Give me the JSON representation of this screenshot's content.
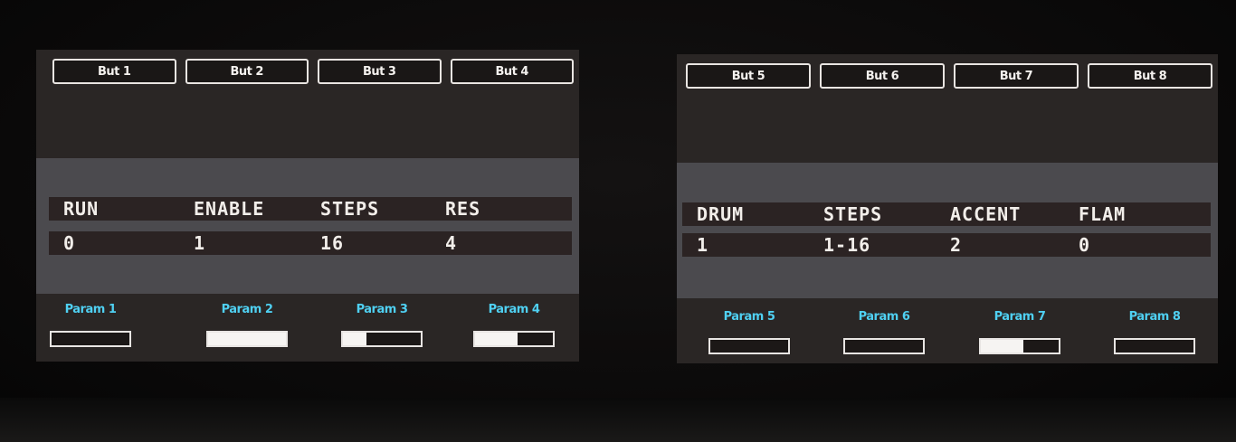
{
  "left_screen": {
    "buttons": [
      {
        "label": "But 1"
      },
      {
        "label": "But 2"
      },
      {
        "label": "But 3"
      },
      {
        "label": "But 4"
      }
    ],
    "columns": [
      {
        "label": "RUN",
        "value": "0"
      },
      {
        "label": "ENABLE",
        "value": "1"
      },
      {
        "label": "STEPS",
        "value": "16"
      },
      {
        "label": "RES",
        "value": "4"
      }
    ],
    "params": [
      {
        "label": "Param 1",
        "fill": 0.0
      },
      {
        "label": "Param 2",
        "fill": 1.0
      },
      {
        "label": "Param 3",
        "fill": 0.3
      },
      {
        "label": "Param 4",
        "fill": 0.55
      }
    ]
  },
  "right_screen": {
    "buttons": [
      {
        "label": "But 5"
      },
      {
        "label": "But 6"
      },
      {
        "label": "But 7"
      },
      {
        "label": "But 8"
      }
    ],
    "columns": [
      {
        "label": "DRUM",
        "value": "1"
      },
      {
        "label": "STEPS",
        "value": "1-16"
      },
      {
        "label": "ACCENT",
        "value": "2"
      },
      {
        "label": "FLAM",
        "value": "0"
      }
    ],
    "params": [
      {
        "label": "Param 5",
        "fill": 0.0
      },
      {
        "label": "Param 6",
        "fill": 0.0
      },
      {
        "label": "Param 7",
        "fill": 0.55
      },
      {
        "label": "Param 8",
        "fill": 0.0
      }
    ]
  },
  "colors": {
    "screen_bg": "#2a2625",
    "band_bg": "#4b4a4e",
    "row_bg": "#2b2323",
    "text": "#f2eeea",
    "param_label": "#4fd0f2",
    "outline": "#e8e5e3"
  }
}
